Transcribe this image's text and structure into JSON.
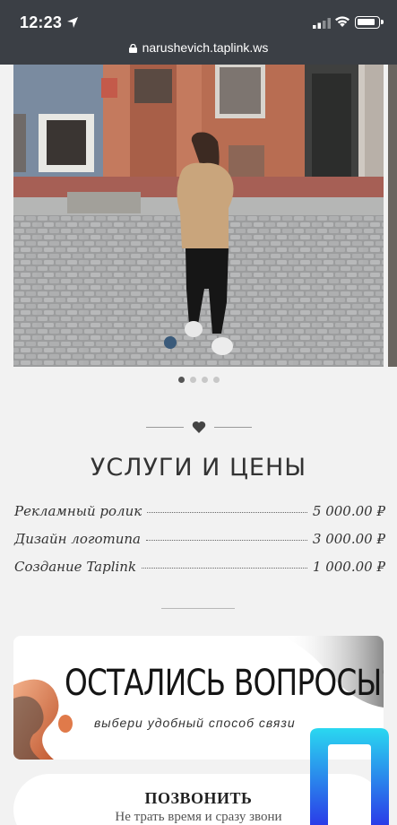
{
  "status_bar": {
    "time": "12:23"
  },
  "browser": {
    "url": "narushevich.taplink.ws"
  },
  "carousel": {
    "dots_total": 4,
    "active_index": 0
  },
  "services": {
    "title": "УСЛУГИ И ЦЕНЫ",
    "items": [
      {
        "name": "Рекламный ролик",
        "price": "5 000.00 ₽"
      },
      {
        "name": "Дизайн логотипа",
        "price": "3 000.00 ₽"
      },
      {
        "name": "Создание Taplink",
        "price": "1 000.00 ₽"
      }
    ]
  },
  "banner": {
    "title": "ОСТАЛИСЬ ВОПРОСЫ?",
    "subtitle": "выбери удобный способ связи"
  },
  "call": {
    "title": "ПОЗВОНИТЬ",
    "subtitle": "Не трать время и сразу звони"
  },
  "colors": {
    "topbar": "#3b3f45",
    "page_bg": "#f2f2f2",
    "heart": "#444444",
    "banner_accent": "#e08a5a"
  }
}
